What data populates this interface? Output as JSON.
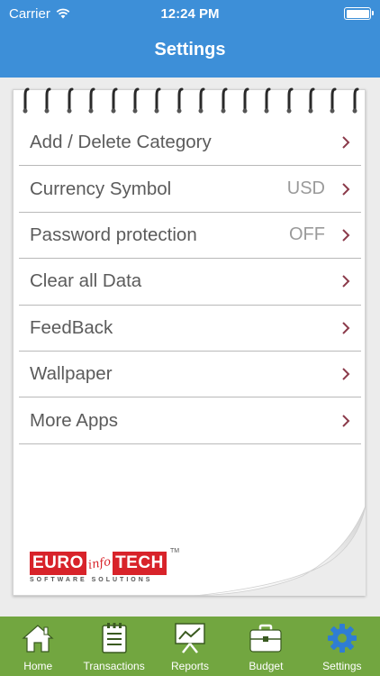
{
  "status_bar": {
    "carrier": "Carrier",
    "time": "12:24 PM"
  },
  "nav": {
    "title": "Settings"
  },
  "settings": {
    "items": [
      {
        "label": "Add / Delete Category",
        "value": ""
      },
      {
        "label": "Currency Symbol",
        "value": "USD"
      },
      {
        "label": "Password protection",
        "value": "OFF"
      },
      {
        "label": "Clear all Data",
        "value": ""
      },
      {
        "label": "FeedBack",
        "value": ""
      },
      {
        "label": "Wallpaper",
        "value": ""
      },
      {
        "label": "More Apps",
        "value": ""
      }
    ]
  },
  "logo": {
    "euro": "EURO",
    "info": "info",
    "tech": "TECH",
    "tm": "TM",
    "subtitle": "SOFTWARE SOLUTIONS"
  },
  "tabbar": {
    "tabs": [
      {
        "label": "Home",
        "icon": "home-icon"
      },
      {
        "label": "Transactions",
        "icon": "transactions-icon"
      },
      {
        "label": "Reports",
        "icon": "reports-icon"
      },
      {
        "label": "Budget",
        "icon": "budget-icon"
      },
      {
        "label": "Settings",
        "icon": "gear-icon"
      }
    ]
  },
  "colors": {
    "header": "#3d8fd8",
    "tabbar": "#72a640",
    "active_tab": "#2f7dd4",
    "chevron": "#8b3a4a",
    "logo_red": "#d8232a"
  }
}
